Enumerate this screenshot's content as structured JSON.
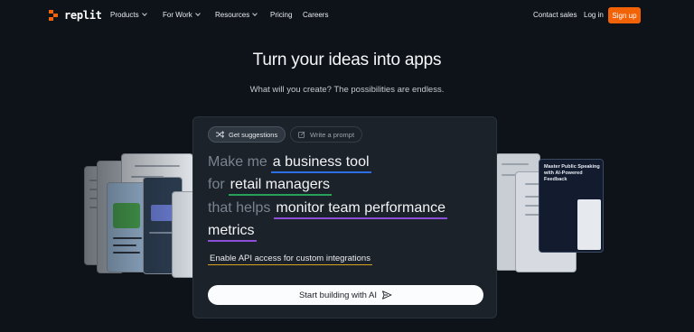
{
  "brand": {
    "name": "replit",
    "accent": "#f26207"
  },
  "nav": {
    "products": "Products",
    "for_work": "For Work",
    "resources": "Resources",
    "pricing": "Pricing",
    "careers": "Careers",
    "contact_sales": "Contact sales",
    "login": "Log in",
    "signup": "Sign up"
  },
  "hero": {
    "title": "Turn your ideas into apps",
    "subtitle": "What will you create? The possibilities are endless."
  },
  "prompt_panel": {
    "chip_suggestions": "Get suggestions",
    "chip_write": "Write a prompt",
    "line1_prefix": "Make me",
    "line1_value": "a business tool",
    "line2_prefix": "for",
    "line2_value": "retail managers",
    "line3_prefix": "that helps",
    "line3_value": "monitor team performance",
    "line4_value": "metrics",
    "api_option": "Enable API access for custom integrations",
    "start_button": "Start building with AI"
  },
  "preview_cards": {
    "right_title": "Master Public Speaking with AI-Powered Feedback"
  },
  "icons": [
    "shuffle-icon",
    "edit-icon",
    "send-icon",
    "chevron-down-icon"
  ]
}
